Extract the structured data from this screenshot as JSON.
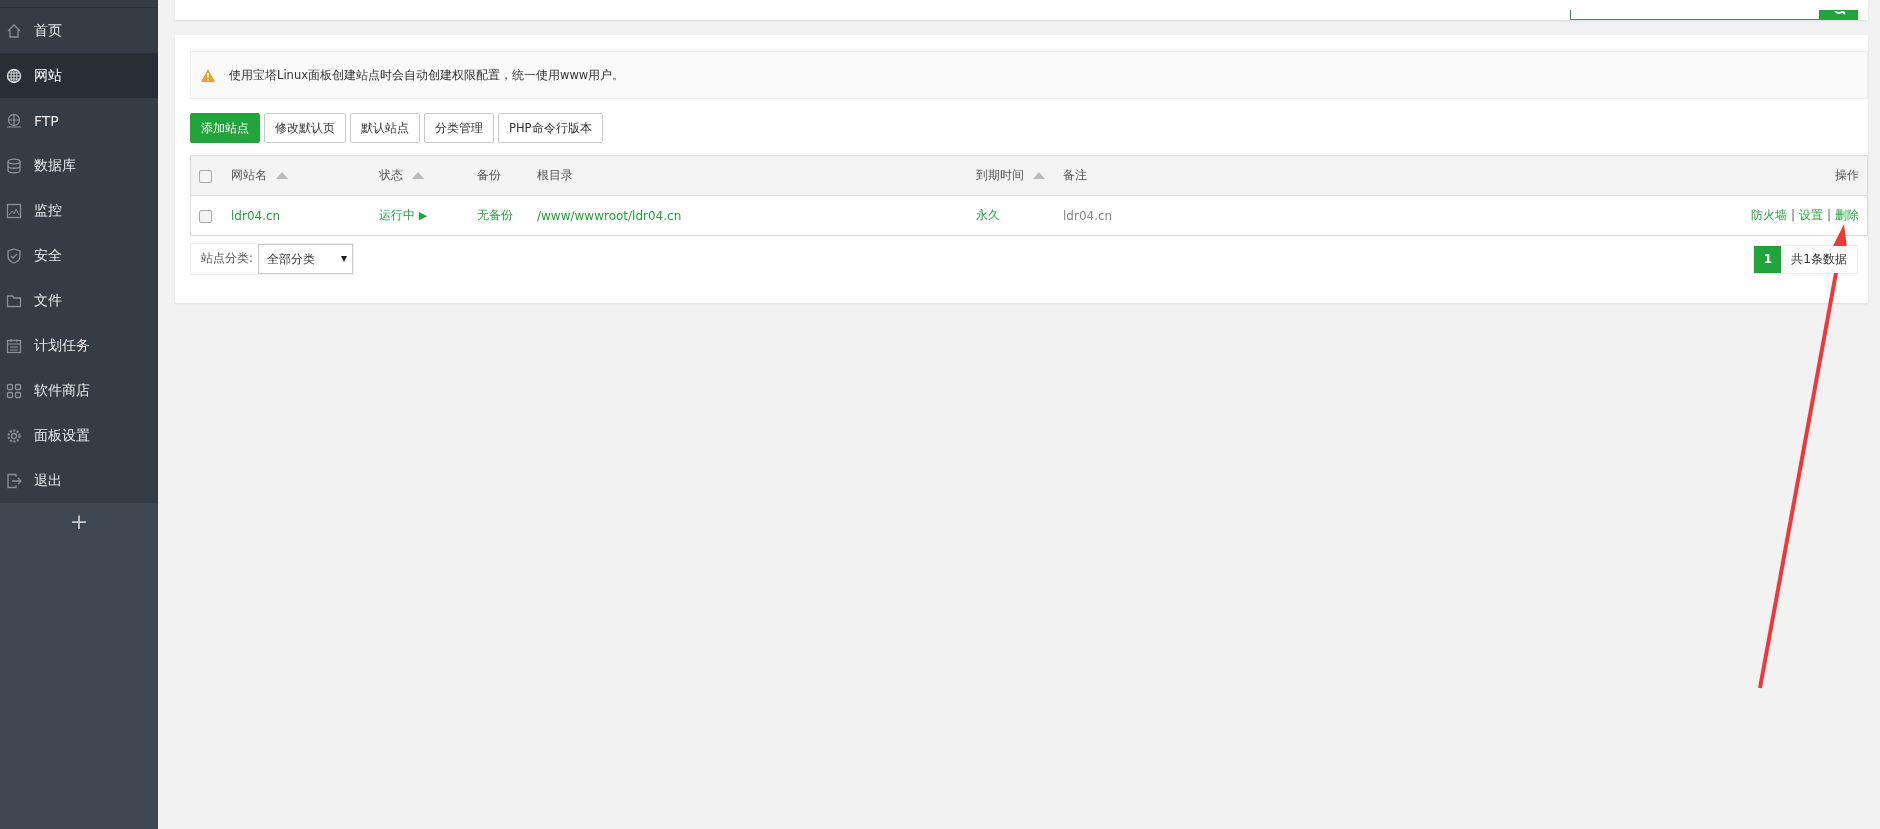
{
  "sidebar": {
    "items": [
      {
        "label": "首页",
        "selected": false
      },
      {
        "label": "网站",
        "selected": true
      },
      {
        "label": "FTP",
        "selected": false
      },
      {
        "label": "数据库",
        "selected": false
      },
      {
        "label": "监控",
        "selected": false
      },
      {
        "label": "安全",
        "selected": false
      },
      {
        "label": "文件",
        "selected": false
      },
      {
        "label": "计划任务",
        "selected": false
      },
      {
        "label": "软件商店",
        "selected": false
      },
      {
        "label": "面板设置",
        "selected": false
      },
      {
        "label": "退出",
        "selected": false
      }
    ],
    "add_button": "+"
  },
  "alert": "使用宝塔Linux面板创建站点时会自动创建权限配置，统一使用www用户。",
  "toolbar": [
    {
      "label": "添加站点",
      "kind": "primary"
    },
    {
      "label": "修改默认页",
      "kind": "default"
    },
    {
      "label": "默认站点",
      "kind": "default"
    },
    {
      "label": "分类管理",
      "kind": "default"
    },
    {
      "label": "PHP命令行版本",
      "kind": "default"
    }
  ],
  "table": {
    "all_checked": false,
    "columns": [
      {
        "label": "网站名",
        "sortable": true
      },
      {
        "label": "状态",
        "sortable": true
      },
      {
        "label": "备份"
      },
      {
        "label": "根目录"
      },
      {
        "label": "到期时间",
        "sortable": true
      },
      {
        "label": "备注"
      },
      {
        "label": "操作"
      }
    ],
    "rows": [
      {
        "checked": false,
        "name": "ldr04.cn",
        "status": "运行中",
        "status_icon": "▶",
        "backup": "无备份",
        "root": "/www/wwwroot/ldr04.cn",
        "expire": "永久",
        "remark": "ldr04.cn",
        "actions": [
          "防火墙",
          "设置",
          "删除"
        ],
        "separator": "|"
      }
    ]
  },
  "footer": {
    "category_label": "站点分类:",
    "category_value": "全部分类",
    "pages": [
      {
        "label": "1",
        "selected": true
      }
    ],
    "total": "共1条数据"
  }
}
